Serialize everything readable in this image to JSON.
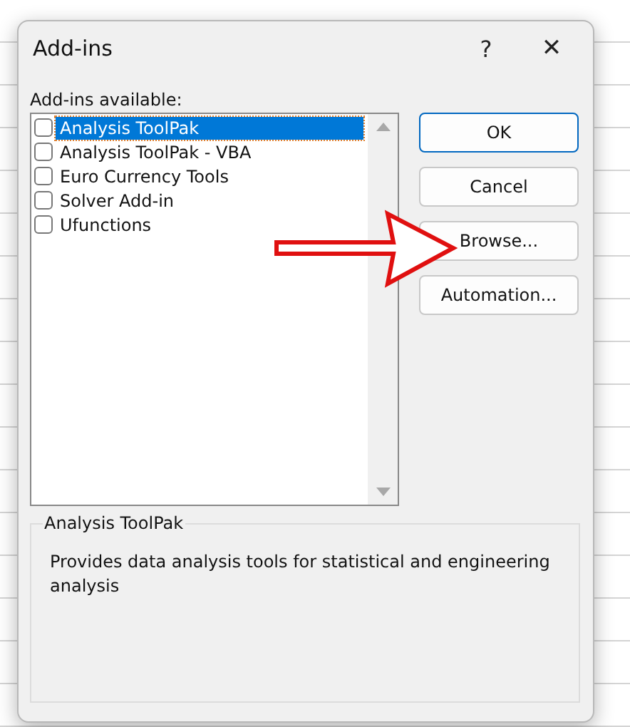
{
  "window": {
    "title": "Add-ins",
    "help": "?",
    "close": "✕"
  },
  "list_label": "Add-ins available:",
  "addins": [
    {
      "label": "Analysis ToolPak",
      "checked": false,
      "selected": true
    },
    {
      "label": "Analysis ToolPak - VBA",
      "checked": false,
      "selected": false
    },
    {
      "label": "Euro Currency Tools",
      "checked": false,
      "selected": false
    },
    {
      "label": "Solver Add-in",
      "checked": false,
      "selected": false
    },
    {
      "label": "Ufunctions",
      "checked": false,
      "selected": false
    }
  ],
  "buttons": [
    {
      "label": "OK",
      "kind": "default"
    },
    {
      "label": "Cancel",
      "kind": "normal"
    },
    {
      "label": "Browse...",
      "kind": "normal"
    },
    {
      "label": "Automation...",
      "kind": "normal"
    }
  ],
  "description": {
    "title": "Analysis ToolPak",
    "text": "Provides data analysis tools for statistical and engineering analysis"
  }
}
